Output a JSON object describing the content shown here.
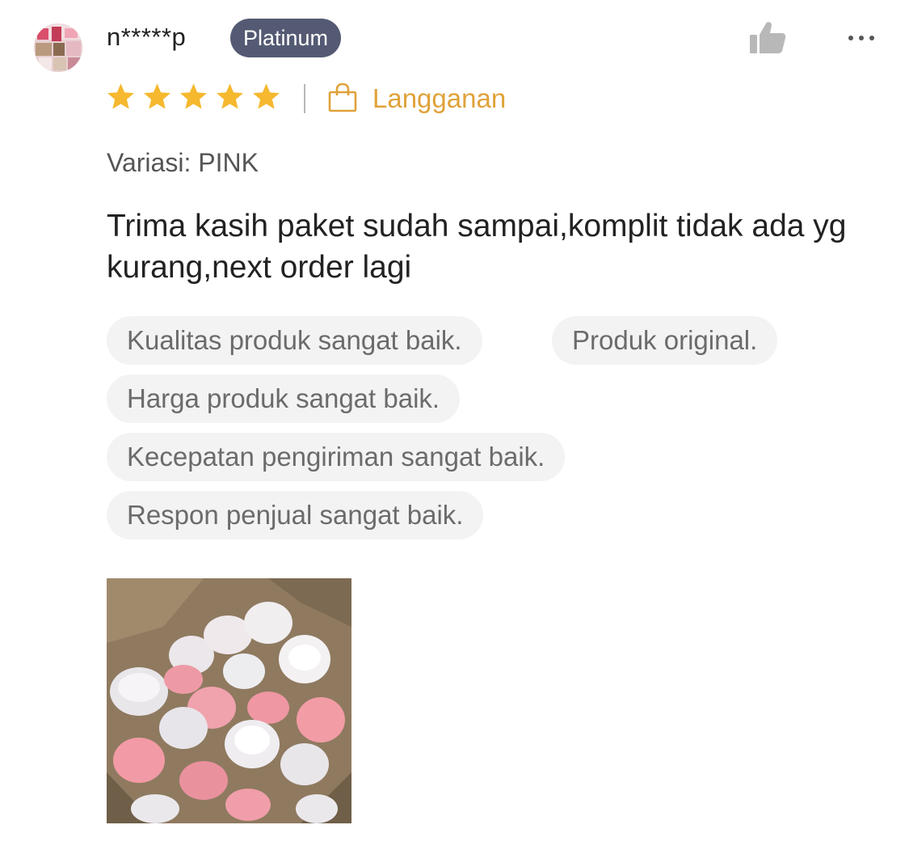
{
  "review": {
    "username": "n*****p",
    "tier_badge": "Platinum",
    "rating": 5,
    "rating_max": 5,
    "subscription_label": "Langganan",
    "variation": "Variasi: PINK",
    "comment": "Trima kasih paket sudah sampai,komplit tidak ada yg kurang,next order lagi",
    "tags": [
      "Kualitas produk sangat baik.",
      "Produk original.",
      "Harga produk sangat baik.",
      "Kecepatan pengiriman sangat baik.",
      "Respon penjual sangat baik."
    ]
  },
  "icons": {
    "like": "thumbs-up-icon",
    "more": "more-horizontal-icon",
    "star": "star-icon",
    "subscription": "shopping-bag-icon"
  },
  "colors": {
    "star": "#F5B82E",
    "subscription": "#E0A23A",
    "badge_bg": "#545A73",
    "tag_bg": "#F3F3F3",
    "tag_text": "#6B6B6B",
    "icon_gray": "#B8B8B8"
  }
}
